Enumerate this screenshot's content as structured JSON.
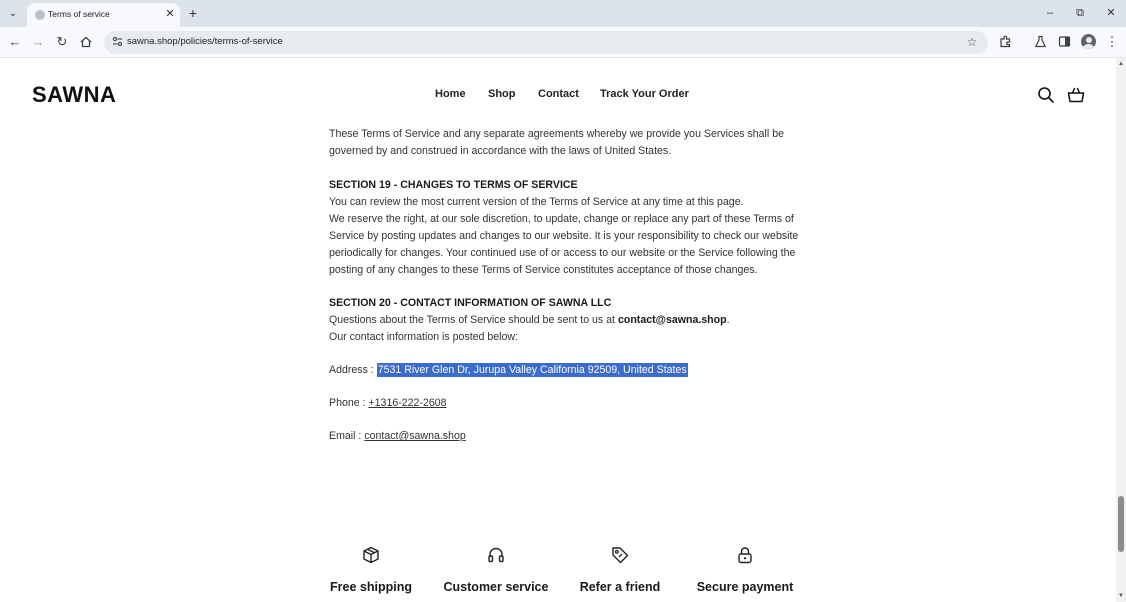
{
  "browser": {
    "tab_title": "Terms of service",
    "url": "sawna.shop/policies/terms-of-service"
  },
  "site": {
    "logo": "SAWNA",
    "nav": [
      "Home",
      "Shop",
      "Contact",
      "Track Your Order"
    ]
  },
  "content": {
    "para_top_line1": "These Terms of Service and any separate agreements whereby we provide you Services shall be",
    "para_top_line2": "governed by and construed in accordance with the laws of United States.",
    "section19_title": "SECTION 19 - CHANGES TO TERMS OF SERVICE",
    "section19_lines": [
      "You can review the most current version of the Terms of Service at any time at this page.",
      "We reserve the right, at our sole discretion, to update, change or replace any part of these Terms of",
      "Service by posting updates and changes to our website. It is your responsibility to check our website",
      "periodically for changes. Your continued use of or access to our website or the Service following the",
      "posting of any changes to these Terms of Service constitutes acceptance of those changes."
    ],
    "section20_title": "SECTION 20 - CONTACT INFORMATION OF SAWNA LLC",
    "section20_line1_prefix": "Questions about the Terms of Service should be sent to us at ",
    "section20_email": "contact@sawna.shop",
    "section20_line1_suffix": ".",
    "section20_line2": "Our contact information is posted below:",
    "address_label": "Address : ",
    "address_value": "7531 River Glen Dr, Jurupa Valley California 92509, United States",
    "phone_label": "Phone : ",
    "phone_value": "+1316-222-2608",
    "email_label": "Email : ",
    "email_value": "contact@sawna.shop"
  },
  "features": [
    {
      "label": "Free shipping",
      "icon": "package-icon"
    },
    {
      "label": "Customer service",
      "icon": "headset-icon"
    },
    {
      "label": "Refer a friend",
      "icon": "tag-icon"
    },
    {
      "label": "Secure payment",
      "icon": "lock-icon"
    }
  ],
  "colors": {
    "selection": "#3a6ccf",
    "tabbar": "#dde3ea",
    "toolbar": "#f7f9fc"
  }
}
